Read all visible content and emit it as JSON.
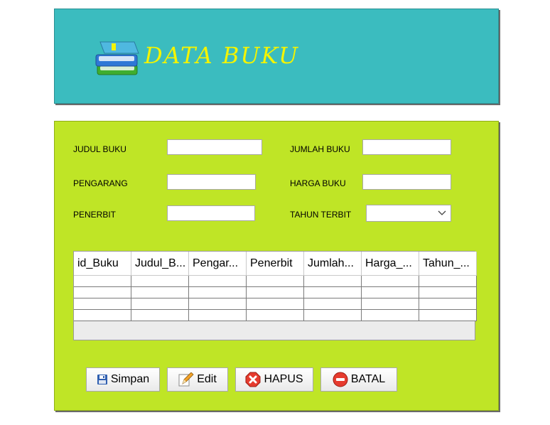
{
  "header": {
    "title": "DATA BUKU",
    "icon": "books-icon"
  },
  "form": {
    "judul_label": "JUDUL BUKU",
    "judul_value": "",
    "jumlah_label": "JUMLAH BUKU",
    "jumlah_value": "",
    "pengarang_label": "PENGARANG",
    "pengarang_value": "",
    "harga_label": "HARGA BUKU",
    "harga_value": "",
    "penerbit_label": "PENERBIT",
    "penerbit_value": "",
    "tahun_label": "TAHUN TERBIT",
    "tahun_value": ""
  },
  "table": {
    "columns": [
      "id_Buku",
      "Judul_B...",
      "Pengar...",
      "Penerbit",
      "Jumlah...",
      "Harga_...",
      "Tahun_..."
    ],
    "rows": [
      [
        "",
        "",
        "",
        "",
        "",
        "",
        ""
      ],
      [
        "",
        "",
        "",
        "",
        "",
        "",
        ""
      ],
      [
        "",
        "",
        "",
        "",
        "",
        "",
        ""
      ],
      [
        "",
        "",
        "",
        "",
        "",
        "",
        ""
      ]
    ]
  },
  "buttons": {
    "simpan": "Simpan",
    "edit": "Edit",
    "hapus": "HAPUS",
    "batal": "BATAL"
  },
  "colors": {
    "header_bg": "#3bbcbf",
    "title": "#f4f400",
    "form_bg": "#bfe526"
  }
}
